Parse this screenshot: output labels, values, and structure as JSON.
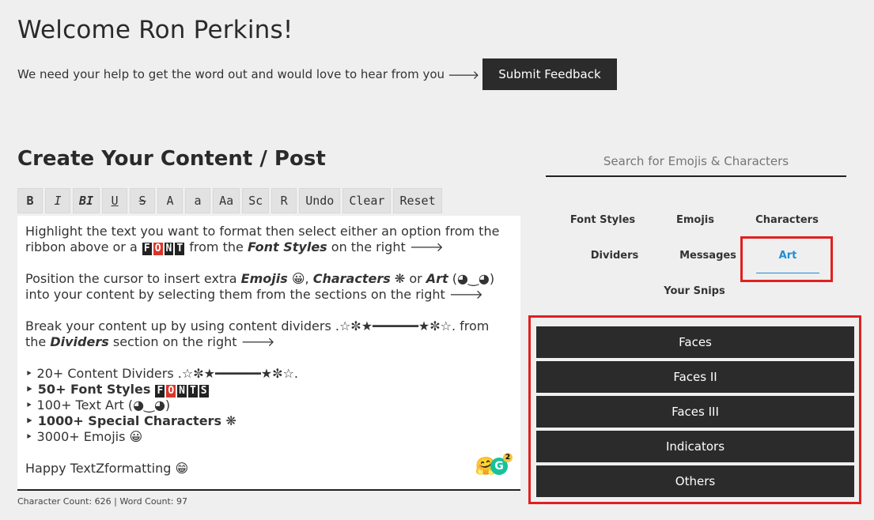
{
  "header": {
    "welcome": "Welcome Ron Perkins!",
    "feedback_text": "We need your help to get the word out and would love to hear from you",
    "feedback_arrow": "🡒",
    "submit_label": "Submit Feedback"
  },
  "editor_section": {
    "title": "Create Your Content / Post",
    "toolbar": [
      "B",
      "I",
      "BI",
      "U",
      "S",
      "A",
      "a",
      "Aa",
      "Sc",
      "R",
      "Undo",
      "Clear",
      "Reset"
    ],
    "content": {
      "p1_a": "Highlight the text you want to format then select either an option from the ribbon above or a",
      "p1_font_letters": [
        "F",
        "O",
        "N",
        "T"
      ],
      "p1_b": "from the",
      "p1_c": "Font Styles",
      "p1_d": "on the right 🡒",
      "p2_a": "Position the cursor to insert extra",
      "p2_b": "Emojis",
      "p2_c": "😀,",
      "p2_d": "Characters",
      "p2_e": "❋ or",
      "p2_f": "Art",
      "p2_g": "(◕‿◕) into your content by selecting them from the sections on the right 🡒",
      "p3_a": "Break your content up by using content dividers .☆✼★━━━━━━★✼☆. from the",
      "p3_b": "Dividers",
      "p3_c": "section on the right 🡒",
      "list": {
        "item1": "‣ 20+ Content Dividers .☆✼★━━━━━━★✼☆.",
        "item2_a": "‣ 50+ Font Styles",
        "item2_letters": [
          "F",
          "O",
          "N",
          "T",
          "S"
        ],
        "item3": "‣ 100+ Text Art (◕‿◕)",
        "item4": "‣ 1000+ Special Characters ❋",
        "item5": "‣ 3000+ Emojis 😀"
      },
      "closing": "Happy TextZformatting 😁"
    },
    "emoji_badge": "🤗",
    "grammarly_letter": "G",
    "grammarly_count": "2",
    "counts": "Character Count: 626 | Word Count: 97"
  },
  "right_panel": {
    "search_placeholder": "Search for Emojis & Characters",
    "tabs": {
      "font_styles": "Font Styles",
      "emojis": "Emojis",
      "characters": "Characters",
      "dividers": "Dividers",
      "messages": "Messages",
      "art": "Art",
      "your_snips": "Your Snips"
    },
    "active_tab": "Art",
    "accent_color": "#1a8fd6",
    "highlight_color": "#e02020",
    "art_categories": [
      "Faces",
      "Faces II",
      "Faces III",
      "Indicators",
      "Others"
    ]
  }
}
